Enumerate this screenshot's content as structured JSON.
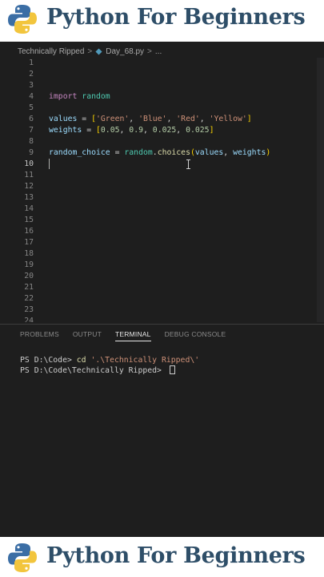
{
  "branding": {
    "title": "Python For Beginners",
    "title_color": "#2e4e68",
    "logo_icon": "python-logo"
  },
  "breadcrumb": {
    "folder": "Technically Ripped",
    "separator": ">",
    "file": "Day_68.py",
    "more": "..."
  },
  "editor": {
    "line_numbers": [
      "1",
      "2",
      "3",
      "4",
      "5",
      "6",
      "7",
      "8",
      "9",
      "10",
      "11",
      "12",
      "13",
      "14",
      "15",
      "16",
      "17",
      "18",
      "19",
      "20",
      "21",
      "22",
      "23",
      "24"
    ],
    "active_line": "10",
    "code": {
      "line3": {
        "kw": "import",
        "mod": "random"
      },
      "line5": {
        "var": "values",
        "eq": " = ",
        "open": "[",
        "s1": "'Green'",
        "s2": "'Blue'",
        "s3": "'Red'",
        "s4": "'Yellow'",
        "comma": ", ",
        "close": "]"
      },
      "line6": {
        "var": "weights",
        "eq": " = ",
        "open": "[",
        "n1": "0.05",
        "n2": "0.9",
        "n3": "0.025",
        "n4": "0.025",
        "comma": ", ",
        "close": "]"
      },
      "line8": {
        "var": "random_choice",
        "eq": " = ",
        "mod": "random",
        "dot": ".",
        "fn": "choices",
        "open": "(",
        "a1": "values",
        "comma": ", ",
        "a2": "weights",
        "close": ")"
      }
    }
  },
  "panel": {
    "tabs": [
      "PROBLEMS",
      "OUTPUT",
      "TERMINAL",
      "DEBUG CONSOLE"
    ],
    "active_tab": "TERMINAL",
    "terminal": {
      "line1_prompt": "PS D:\\Code> ",
      "line1_cmd": "cd",
      "line1_arg": " '.\\Technically Ripped\\'",
      "line2_prompt": "PS D:\\Code\\Technically Ripped> "
    }
  }
}
